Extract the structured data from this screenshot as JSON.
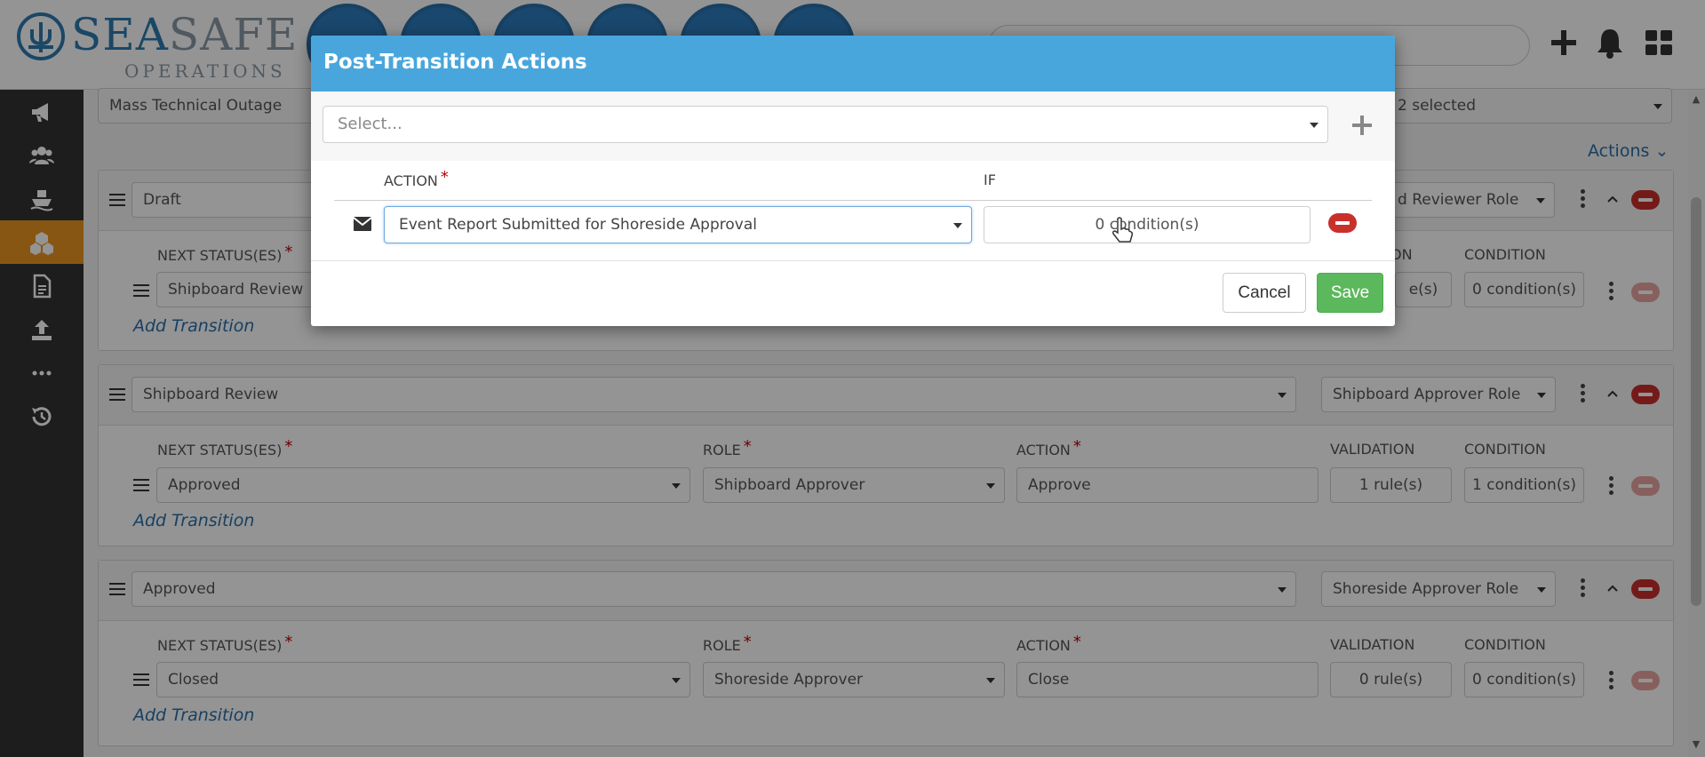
{
  "header": {
    "logo_main_a": "SEA",
    "logo_main_b": "SAFE",
    "logo_sub": "OPERATIONS",
    "icons": [
      "dashboard-icon",
      "edit-icon",
      "list-icon",
      "calendar-icon",
      "chart-icon",
      "settings-icon",
      "plus-icon",
      "bell-icon",
      "grid-icon"
    ]
  },
  "sidebar": {
    "items": [
      "megaphone-icon",
      "users-icon",
      "ship-icon",
      "cubes-icon",
      "document-icon",
      "upload-icon",
      "more-icon",
      "history-icon"
    ],
    "active_index": 3
  },
  "page": {
    "top_left_value": "Mass Technical Outage",
    "top_right_value": "2 selected",
    "actions_label": "Actions"
  },
  "workflow": {
    "col_next_status": "NEXT STATUS(ES)",
    "col_role": "ROLE",
    "col_action": "ACTION",
    "col_validation": "VALIDATION",
    "col_condition": "CONDITION",
    "add_transition": "Add Transition",
    "statuses": [
      {
        "status": "Draft",
        "role": "d Reviewer Role",
        "transition": {
          "next": "Shipboard Review",
          "role": "",
          "action": "",
          "validation": "e(s)",
          "condition": "0 condition(s)"
        }
      },
      {
        "status": "Shipboard Review",
        "role": "Shipboard Approver Role",
        "transition": {
          "next": "Approved",
          "role": "Shipboard Approver",
          "action": "Approve",
          "validation": "1 rule(s)",
          "condition": "1 condition(s)"
        }
      },
      {
        "status": "Approved",
        "role": "Shoreside Approver Role",
        "transition": {
          "next": "Closed",
          "role": "Shoreside Approver",
          "action": "Close",
          "validation": "0 rule(s)",
          "condition": "0 condition(s)"
        }
      }
    ],
    "partial_labels": {
      "validation": "ON"
    }
  },
  "modal": {
    "title": "Post-Transition Actions",
    "select_placeholder": "Select...",
    "col_action": "ACTION",
    "col_if": "IF",
    "row": {
      "action": "Event Report Submitted for Shoreside Approval",
      "if": "0 condition(s)"
    },
    "cancel_label": "Cancel",
    "save_label": "Save"
  },
  "colors": {
    "modal_header": "#49a6dc",
    "save_button": "#5cb85c",
    "danger": "#c9302c",
    "sidebar_active": "#e8951f",
    "brand_blue": "#2b7bbd"
  }
}
